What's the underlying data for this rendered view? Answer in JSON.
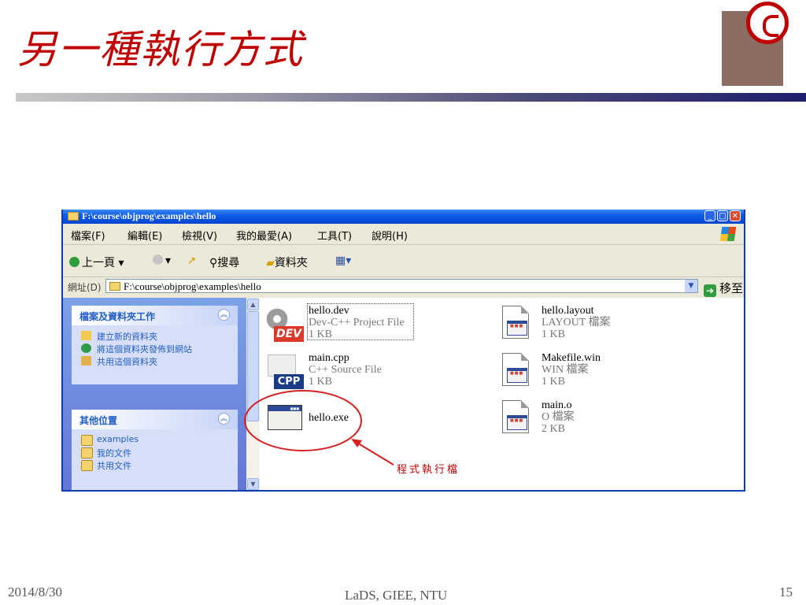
{
  "slide": {
    "title": "另一種執行方式",
    "footer_date": "2014/8/30",
    "footer_center": "LaDS, GIEE, NTU",
    "page_number": "15",
    "annotation": "程式執行檔"
  },
  "window": {
    "title": "F:\\course\\objprog\\examples\\hello",
    "menu": [
      "檔案(F)",
      "編輯(E)",
      "檢視(V)",
      "我的最愛(A)",
      "工具(T)",
      "說明(H)"
    ],
    "toolbar": {
      "back": "上一頁",
      "search": "搜尋",
      "folders": "資料夾"
    },
    "address": {
      "label": "網址(D)",
      "value": "F:\\course\\objprog\\examples\\hello",
      "go": "移至"
    },
    "task_pane": {
      "file_tasks_header": "檔案及資料夾工作",
      "file_tasks": [
        "建立新的資料夾",
        "將這個資料夾發佈到網站",
        "共用這個資料夾"
      ],
      "other_places_header": "其他位置",
      "other_places": [
        "examples",
        "我的文件",
        "共用文件"
      ]
    },
    "files": [
      {
        "name": "hello.dev",
        "type": "Dev-C++ Project File",
        "size": "1 KB",
        "icon": "dev-project-icon"
      },
      {
        "name": "main.cpp",
        "type": "C++ Source File",
        "size": "1 KB",
        "icon": "cpp-source-icon"
      },
      {
        "name": "hello.exe",
        "type": "",
        "size": "",
        "icon": "executable-icon"
      },
      {
        "name": "hello.layout",
        "type": "LAYOUT 檔案",
        "size": "1 KB",
        "icon": "generic-file-icon"
      },
      {
        "name": "Makefile.win",
        "type": "WIN 檔案",
        "size": "1 KB",
        "icon": "generic-file-icon"
      },
      {
        "name": "main.o",
        "type": "O 檔案",
        "size": "2 KB",
        "icon": "generic-file-icon"
      }
    ]
  },
  "colors": {
    "title_red": "#c00000",
    "xp_blue": "#0545d0",
    "task_link": "#215dc6"
  }
}
